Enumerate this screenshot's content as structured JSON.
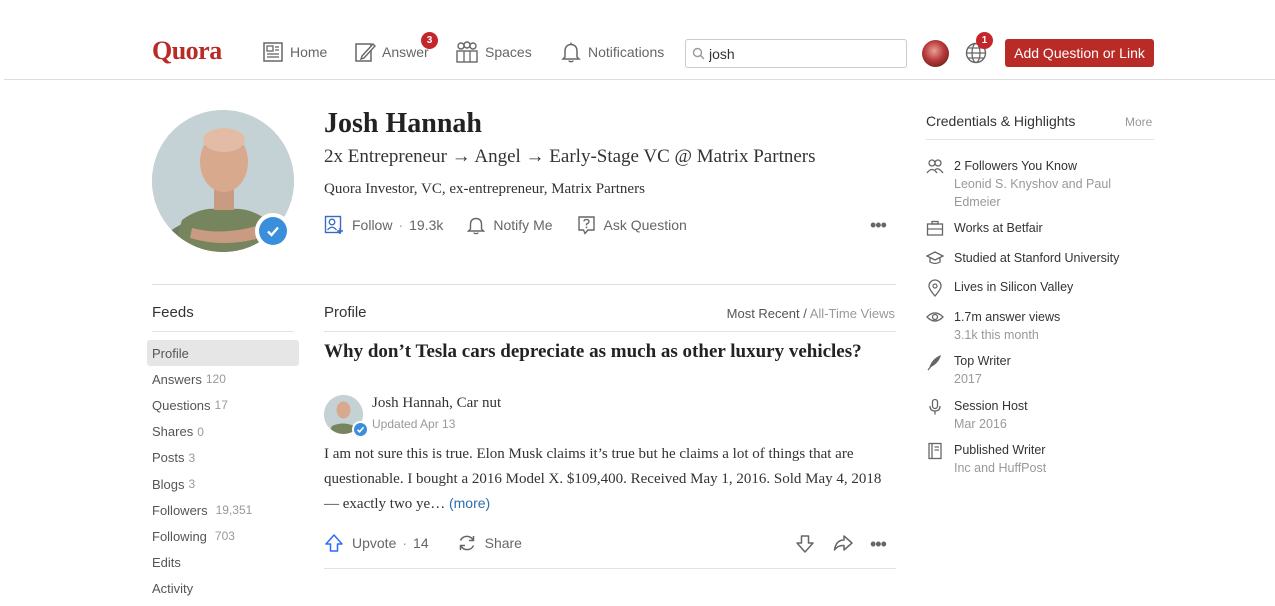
{
  "header": {
    "logo": "Quora",
    "nav": [
      {
        "label": "Home",
        "icon": "home-icon"
      },
      {
        "label": "Answer",
        "icon": "answer-icon",
        "badge": "3"
      },
      {
        "label": "Spaces",
        "icon": "spaces-icon"
      },
      {
        "label": "Notifications",
        "icon": "bell-icon"
      }
    ],
    "search_value": "josh",
    "globe_badge": "1",
    "add_button": "Add Question or Link",
    "brand_color": "#b92b27"
  },
  "profile": {
    "name": "Josh Hannah",
    "tagline": "2x Entrepreneur → Angel → Early-Stage VC @ Matrix Partners",
    "subline": "Quora Investor, VC, ex-entrepreneur, Matrix Partners",
    "follow_label": "Follow",
    "follow_count": "19.3k",
    "notify_label": "Notify Me",
    "ask_label": "Ask Question",
    "more": "•••"
  },
  "feeds": {
    "title": "Feeds",
    "items": [
      {
        "label": "Profile",
        "count": ""
      },
      {
        "label": "Answers",
        "count": "120"
      },
      {
        "label": "Questions",
        "count": "17"
      },
      {
        "label": "Shares",
        "count": "0"
      },
      {
        "label": "Posts",
        "count": "3"
      },
      {
        "label": "Blogs",
        "count": "3"
      },
      {
        "label": "Followers",
        "count": "19,351"
      },
      {
        "label": "Following",
        "count": "703"
      },
      {
        "label": "Edits",
        "count": ""
      },
      {
        "label": "Activity",
        "count": ""
      }
    ]
  },
  "main": {
    "tab": "Profile",
    "sort_active": "Most Recent",
    "sort_sep": " / ",
    "sort_other": "All-Time Views",
    "question": "Why don’t Tesla cars depreciate as much as other luxury vehicles?",
    "author": "Josh Hannah, Car nut",
    "date": "Updated Apr 13",
    "answer": "I am not sure this is true. Elon Musk claims it’s true but he claims a lot of things that are questionable. I bought a 2016 Model X. $109,400. Received May 1, 2016. Sold May 4, 2018 — exactly two ye… ",
    "more_link": "(more)",
    "upvote_label": "Upvote",
    "upvote_count": "14",
    "share_label": "Share",
    "dots": "•••"
  },
  "credentials": {
    "title": "Credentials & Highlights",
    "more": "More",
    "items": [
      {
        "icon": "people-icon",
        "text": "2 Followers You Know",
        "sub": "Leonid S. Knyshov and Paul Edmeier"
      },
      {
        "icon": "briefcase-icon",
        "text": "Works at Betfair",
        "sub": ""
      },
      {
        "icon": "graduation-cap-icon",
        "text": "Studied at Stanford University",
        "sub": ""
      },
      {
        "icon": "location-pin-icon",
        "text": "Lives in Silicon Valley",
        "sub": ""
      },
      {
        "icon": "eye-icon",
        "text": "1.7m answer views",
        "sub": "3.1k this month"
      },
      {
        "icon": "quill-icon",
        "text": "Top Writer",
        "sub": "2017"
      },
      {
        "icon": "microphone-icon",
        "text": "Session Host",
        "sub": "Mar 2016"
      },
      {
        "icon": "book-icon",
        "text": "Published Writer",
        "sub": "Inc and HuffPost"
      }
    ]
  }
}
